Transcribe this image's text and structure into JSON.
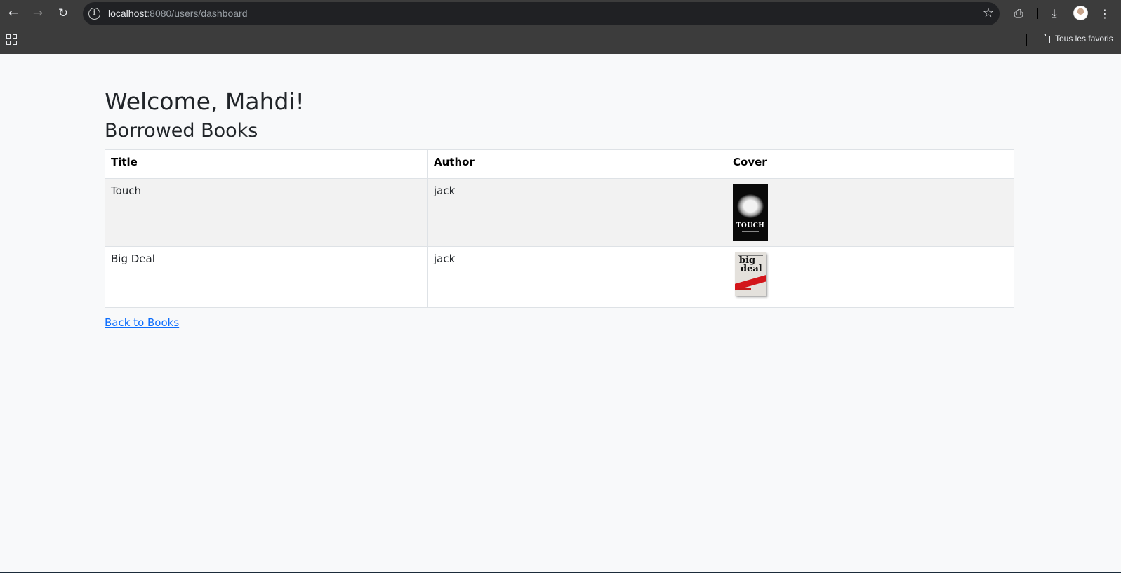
{
  "browser": {
    "url_host": "localhost",
    "url_rest": ":8080/users/dashboard",
    "bookmarks_folder": "Tous les favoris"
  },
  "page": {
    "welcome": "Welcome, Mahdi!",
    "section_title": "Borrowed Books",
    "table": {
      "headers": [
        "Title",
        "Author",
        "Cover"
      ],
      "rows": [
        {
          "title": "Touch",
          "author": "jack",
          "cover_icon": "touch-cover-image"
        },
        {
          "title": "Big Deal",
          "author": "jack",
          "cover_icon": "big-deal-cover-image"
        }
      ]
    },
    "back_link": "Back to Books"
  },
  "covers": {
    "touch": {
      "title": "TOUCH"
    },
    "big_deal": {
      "line1": "big",
      "line2": "deal"
    }
  },
  "colors": {
    "link": "#0d6efd",
    "chrome": "#3c3c3c",
    "omnibox": "#202124"
  }
}
